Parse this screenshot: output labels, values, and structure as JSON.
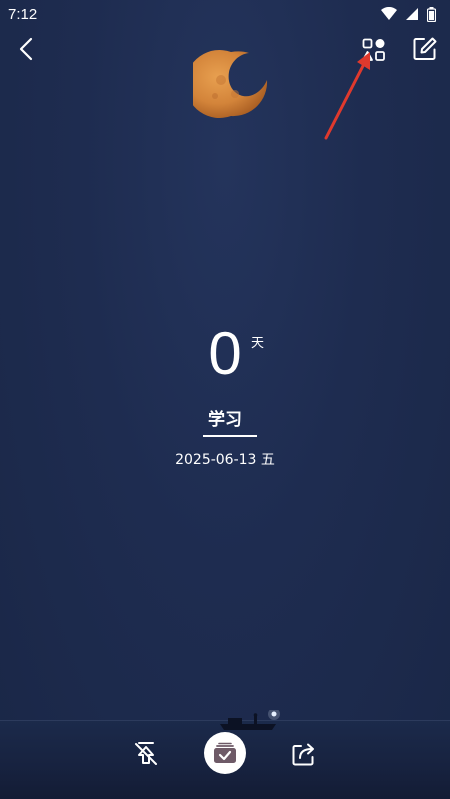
{
  "status_bar": {
    "time": "7:12",
    "icons": [
      "wifi-icon",
      "signal-icon",
      "battery-icon"
    ]
  },
  "top_bar": {
    "back_icon": "chevron-left-icon",
    "theme_icon": "shapes-icon",
    "edit_icon": "edit-icon"
  },
  "counter": {
    "value": "0",
    "unit": "天"
  },
  "event": {
    "title": "学习",
    "date": "2025-06-13 五"
  },
  "bottom_bar": {
    "left_icon": "unpin-icon",
    "center_icon": "check-box-icon",
    "right_icon": "share-icon"
  },
  "colors": {
    "background": "#1e2c50",
    "moon": "#d98a3a",
    "annotation_arrow": "#e0392d",
    "foreground": "#ffffff"
  }
}
